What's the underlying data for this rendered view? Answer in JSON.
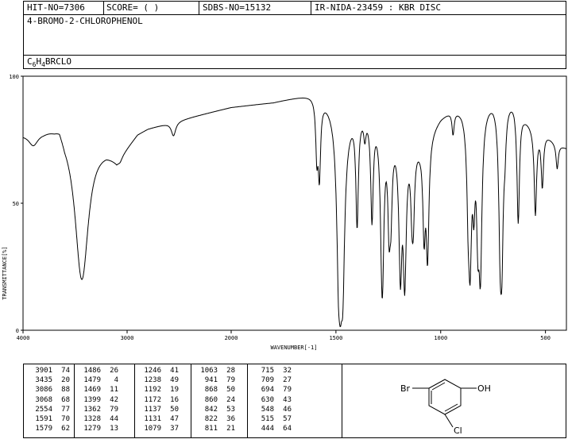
{
  "header": {
    "hit_no": "HIT-NO=7306",
    "score": "SCORE=  (   )",
    "sdbs_no": "SDBS-NO=15132",
    "ir_info": "IR-NIDA-23459 : KBR DISC",
    "compound_name": "4-BROMO-2-CHLOROPHENOL",
    "formula_main": "C",
    "formula_sub1": "6",
    "formula_mid": "H",
    "formula_sub2": "4",
    "formula_tail": "BRCLO"
  },
  "chart_data": {
    "type": "line",
    "title": "",
    "xlabel": "WAVENUMBER[-1]",
    "ylabel": "TRANSMITTANCE[%]",
    "xlim": [
      4000,
      400
    ],
    "ylim": [
      0,
      100
    ],
    "x_ticks": [
      4000,
      3000,
      2000,
      1500,
      1000,
      500
    ],
    "x_tick_labels": [
      "4000",
      "3000",
      "2000",
      "1500",
      "1000",
      "500"
    ],
    "y_ticks": [
      0,
      50,
      100
    ],
    "y_tick_labels": [
      "0",
      "50",
      "100"
    ],
    "grid": false,
    "baseline": [
      [
        4000,
        78
      ],
      [
        3900,
        79
      ],
      [
        3800,
        80
      ],
      [
        3700,
        82
      ],
      [
        3650,
        84
      ],
      [
        3600,
        80
      ],
      [
        3300,
        74
      ],
      [
        3200,
        72
      ],
      [
        3150,
        70
      ],
      [
        3100,
        68
      ],
      [
        3000,
        73
      ],
      [
        2900,
        78
      ],
      [
        2800,
        80
      ],
      [
        2600,
        82
      ],
      [
        2400,
        84
      ],
      [
        2200,
        86
      ],
      [
        2000,
        88
      ],
      [
        1900,
        89
      ],
      [
        1800,
        90
      ],
      [
        1750,
        91
      ],
      [
        1700,
        92
      ],
      [
        1650,
        93
      ],
      [
        1600,
        94
      ],
      [
        1550,
        92
      ],
      [
        1500,
        90
      ],
      [
        1450,
        85
      ],
      [
        1400,
        88
      ],
      [
        1350,
        87
      ],
      [
        1300,
        85
      ],
      [
        1250,
        82
      ],
      [
        1200,
        78
      ],
      [
        1150,
        76
      ],
      [
        1100,
        75
      ],
      [
        1050,
        80
      ],
      [
        1000,
        85
      ],
      [
        950,
        88
      ],
      [
        900,
        89
      ],
      [
        850,
        88
      ],
      [
        800,
        90
      ],
      [
        750,
        93
      ],
      [
        700,
        94
      ],
      [
        650,
        92
      ],
      [
        600,
        85
      ],
      [
        550,
        80
      ],
      [
        500,
        78
      ],
      [
        450,
        74
      ],
      [
        400,
        72
      ]
    ],
    "peak_table": [
      [
        3901,
        74
      ],
      [
        3435,
        20
      ],
      [
        3086,
        88
      ],
      [
        3068,
        68
      ],
      [
        2554,
        77
      ],
      [
        1591,
        70
      ],
      [
        1579,
        62
      ],
      [
        1486,
        26
      ],
      [
        1479,
        4
      ],
      [
        1469,
        11
      ],
      [
        1399,
        42
      ],
      [
        1362,
        79
      ],
      [
        1328,
        44
      ],
      [
        1279,
        13
      ],
      [
        1246,
        41
      ],
      [
        1238,
        49
      ],
      [
        1192,
        19
      ],
      [
        1172,
        16
      ],
      [
        1137,
        50
      ],
      [
        1131,
        47
      ],
      [
        1079,
        37
      ],
      [
        1063,
        28
      ],
      [
        941,
        79
      ],
      [
        868,
        50
      ],
      [
        860,
        24
      ],
      [
        842,
        53
      ],
      [
        822,
        36
      ],
      [
        811,
        21
      ],
      [
        715,
        32
      ],
      [
        709,
        27
      ],
      [
        694,
        79
      ],
      [
        630,
        43
      ],
      [
        548,
        46
      ],
      [
        515,
        57
      ],
      [
        444,
        64
      ]
    ],
    "peak_table_text": [
      [
        "3901",
        "74"
      ],
      [
        "3435",
        "20"
      ],
      [
        "3086",
        "88"
      ],
      [
        "3068",
        "68"
      ],
      [
        "2554",
        "77"
      ],
      [
        "1591",
        "70"
      ],
      [
        "1579",
        "62"
      ],
      [
        "1486",
        "26"
      ],
      [
        "1479",
        "4"
      ],
      [
        "1469",
        "11"
      ],
      [
        "1399",
        "42"
      ],
      [
        "1362",
        "79"
      ],
      [
        "1328",
        "44"
      ],
      [
        "1279",
        "13"
      ],
      [
        "1246",
        "41"
      ],
      [
        "1238",
        "49"
      ],
      [
        "1192",
        "19"
      ],
      [
        "1172",
        "16"
      ],
      [
        "1137",
        "50"
      ],
      [
        "1131",
        "47"
      ],
      [
        "1079",
        "37"
      ],
      [
        "1063",
        "28"
      ],
      [
        "941",
        "79"
      ],
      [
        "868",
        "50"
      ],
      [
        "860",
        "24"
      ],
      [
        "842",
        "53"
      ],
      [
        "822",
        "36"
      ],
      [
        "811",
        "21"
      ],
      [
        "715",
        "32"
      ],
      [
        "709",
        "27"
      ],
      [
        "694",
        "79"
      ],
      [
        "630",
        "43"
      ],
      [
        "548",
        "46"
      ],
      [
        "515",
        "57"
      ],
      [
        "444",
        "64"
      ]
    ]
  },
  "structure": {
    "br_label": "Br",
    "oh_label": "OH",
    "cl_label": "Cl"
  }
}
